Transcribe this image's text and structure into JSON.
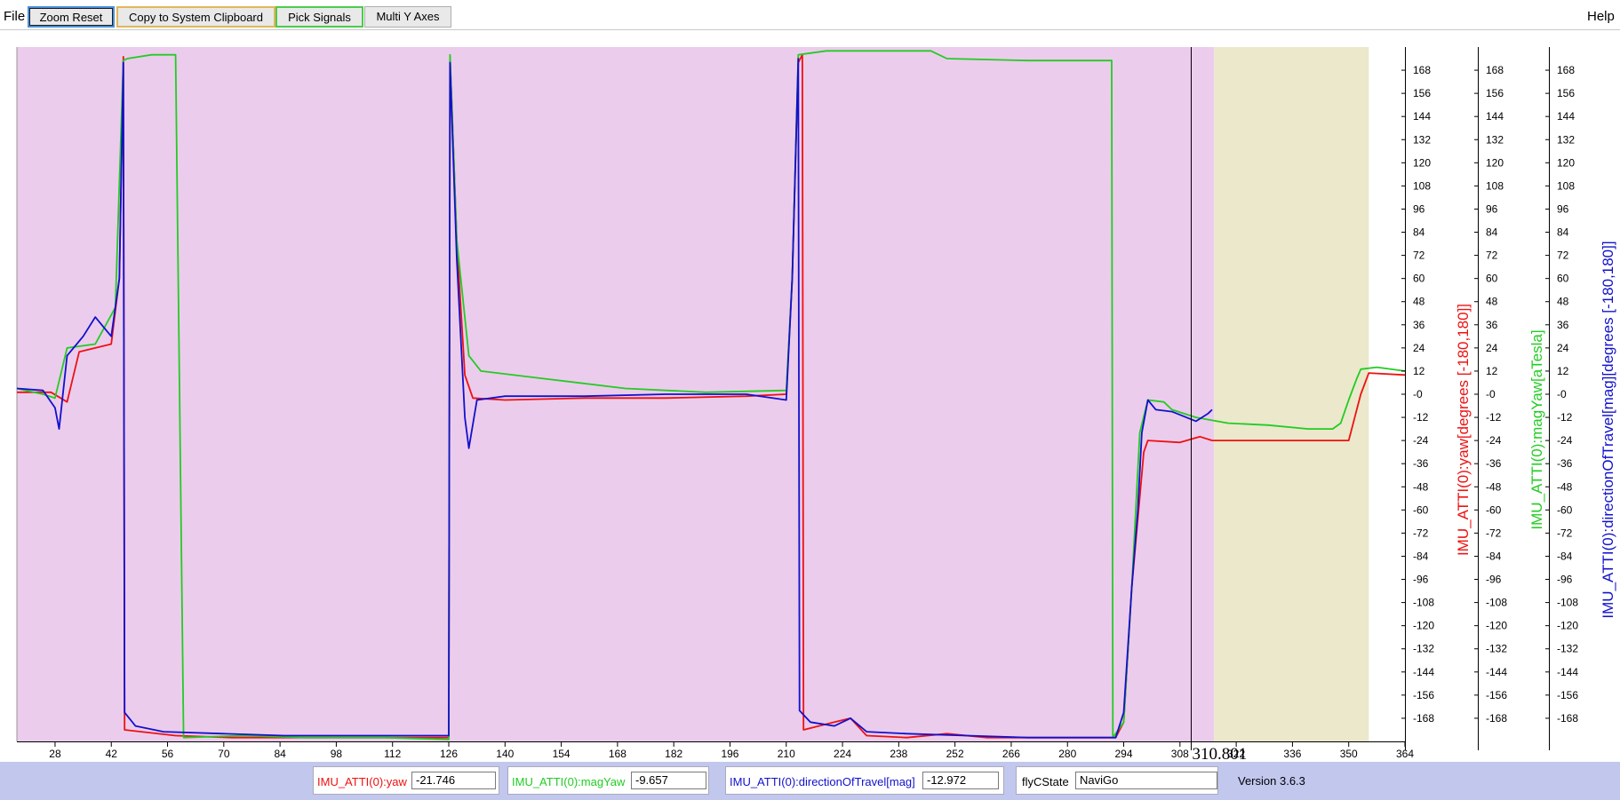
{
  "toolbar": {
    "file_menu": "File",
    "help_menu": "Help",
    "zoom_reset": "Zoom Reset",
    "copy_clipboard": "Copy to System Clipboard",
    "pick_signals": "Pick Signals",
    "multi_y_axes": "Multi Y Axes"
  },
  "status": {
    "yaw_label": "IMU_ATTI(0):yaw",
    "yaw_value": "-21.746",
    "magyaw_label": "IMU_ATTI(0):magYaw",
    "magyaw_value": "-9.657",
    "dir_label": "IMU_ATTI(0):directionOfTravel[mag]",
    "dir_value": "-12.972",
    "flyc_label": "flyCState",
    "flyc_value": "NaviGo",
    "version": "Version 3.6.3"
  },
  "colors": {
    "yaw": "#ee1111",
    "magYaw": "#22cc22",
    "directionOfTravel": "#1111cc",
    "bg_navi": "#ecccec",
    "bg_other": "#ebe8cc"
  },
  "chart_data": {
    "type": "line",
    "cursor_label": "310.801",
    "cursor_x": 310.801,
    "xlim": [
      18.5,
      364
    ],
    "x_ticks": [
      "28",
      "42",
      "56",
      "70",
      "84",
      "98",
      "112",
      "126",
      "140",
      "154",
      "168",
      "182",
      "196",
      "210",
      "224",
      "238",
      "252",
      "266",
      "280",
      "294",
      "308",
      "322",
      "336",
      "350",
      "364"
    ],
    "ylim": [
      -180,
      180
    ],
    "y_ticks": [
      "168",
      "156",
      "144",
      "132",
      "120",
      "108",
      "96",
      "84",
      "72",
      "60",
      "48",
      "36",
      "24",
      "12",
      "-0",
      "-12",
      "-24",
      "-36",
      "-48",
      "-60",
      "-72",
      "-84",
      "-96",
      "-108",
      "-120",
      "-132",
      "-144",
      "-156",
      "-168"
    ],
    "axes": [
      {
        "label": "IMU_ATTI(0):yaw[degrees [-180,180]]",
        "color": "#ee1111"
      },
      {
        "label": "IMU_ATTI(0):magYaw[aTesla]",
        "color": "#22cc22"
      },
      {
        "label": "IMU_ATTI(0):directionOfTravel[mag][degrees [-180,180]]",
        "color": "#1111cc"
      }
    ],
    "background_regions": [
      {
        "from": 18.5,
        "to": 316.5,
        "state": "NaviGo",
        "color": "#ecccec"
      },
      {
        "from": 316.5,
        "to": 355.0,
        "state": "other",
        "color": "#ebe8cc"
      }
    ],
    "series": [
      {
        "name": "IMU_ATTI(0):yaw",
        "color": "#ee1111",
        "points": [
          [
            18.5,
            1
          ],
          [
            27,
            1
          ],
          [
            31,
            -4
          ],
          [
            34,
            22
          ],
          [
            42,
            26
          ],
          [
            44,
            60
          ],
          [
            45,
            175
          ],
          [
            45.3,
            -174
          ],
          [
            58,
            -177
          ],
          [
            72,
            -178
          ],
          [
            84,
            -178
          ],
          [
            100,
            -178
          ],
          [
            114,
            -178
          ],
          [
            126,
            -178
          ],
          [
            126.3,
            175
          ],
          [
            128,
            80
          ],
          [
            130,
            10
          ],
          [
            132,
            -2
          ],
          [
            140,
            -3
          ],
          [
            160,
            -2
          ],
          [
            180,
            -2
          ],
          [
            200,
            -1
          ],
          [
            210,
            0
          ],
          [
            211.5,
            60
          ],
          [
            213,
            172
          ],
          [
            214,
            176
          ],
          [
            214.3,
            -174
          ],
          [
            222,
            -170
          ],
          [
            226,
            -168
          ],
          [
            230,
            -177
          ],
          [
            240,
            -178
          ],
          [
            250,
            -176
          ],
          [
            260,
            -178
          ],
          [
            275,
            -178
          ],
          [
            292,
            -178
          ],
          [
            294,
            -170
          ],
          [
            296,
            -100
          ],
          [
            299,
            -30
          ],
          [
            300,
            -24
          ],
          [
            308,
            -25
          ],
          [
            313,
            -22
          ],
          [
            316,
            -24
          ],
          [
            330,
            -24
          ],
          [
            345,
            -24
          ],
          [
            350,
            -24
          ],
          [
            353,
            0
          ],
          [
            355,
            11
          ],
          [
            364,
            10
          ]
        ]
      },
      {
        "name": "IMU_ATTI(0):magYaw",
        "color": "#22cc22",
        "points": [
          [
            18.5,
            3
          ],
          [
            25,
            0
          ],
          [
            28,
            -2
          ],
          [
            31,
            24
          ],
          [
            38,
            26
          ],
          [
            43,
            45
          ],
          [
            45,
            173
          ],
          [
            46,
            174
          ],
          [
            52,
            176
          ],
          [
            58,
            176
          ],
          [
            60,
            -178
          ],
          [
            75,
            -177
          ],
          [
            90,
            -178
          ],
          [
            110,
            -178
          ],
          [
            126,
            -179
          ],
          [
            126.3,
            176
          ],
          [
            128,
            80
          ],
          [
            131,
            20
          ],
          [
            134,
            12
          ],
          [
            150,
            8
          ],
          [
            170,
            3
          ],
          [
            190,
            1
          ],
          [
            210,
            2
          ],
          [
            211.5,
            60
          ],
          [
            213,
            176
          ],
          [
            220,
            178
          ],
          [
            230,
            178
          ],
          [
            246,
            178
          ],
          [
            250,
            174
          ],
          [
            270,
            173
          ],
          [
            291,
            173
          ],
          [
            291.3,
            -178
          ],
          [
            294,
            -170
          ],
          [
            296,
            -100
          ],
          [
            298,
            -20
          ],
          [
            300,
            -3
          ],
          [
            304,
            -4
          ],
          [
            306,
            -8
          ],
          [
            312,
            -12
          ],
          [
            320,
            -15
          ],
          [
            330,
            -16
          ],
          [
            340,
            -18
          ],
          [
            346,
            -18
          ],
          [
            348,
            -15
          ],
          [
            350,
            -3
          ],
          [
            352,
            8
          ],
          [
            353,
            13
          ],
          [
            357,
            14
          ],
          [
            364,
            12
          ]
        ]
      },
      {
        "name": "IMU_ATTI(0):directionOfTravel[mag]",
        "color": "#1111cc",
        "points": [
          [
            18.5,
            3
          ],
          [
            25,
            2
          ],
          [
            28,
            -7
          ],
          [
            29,
            -18
          ],
          [
            31,
            20
          ],
          [
            35,
            30
          ],
          [
            38,
            40
          ],
          [
            42,
            30
          ],
          [
            44,
            60
          ],
          [
            45,
            172
          ],
          [
            45.3,
            -165
          ],
          [
            48,
            -172
          ],
          [
            55,
            -175
          ],
          [
            70,
            -176
          ],
          [
            85,
            -177
          ],
          [
            100,
            -177
          ],
          [
            115,
            -177
          ],
          [
            126,
            -177
          ],
          [
            126.3,
            172
          ],
          [
            128,
            70
          ],
          [
            130,
            -12
          ],
          [
            131,
            -28
          ],
          [
            133,
            -3
          ],
          [
            140,
            -1
          ],
          [
            160,
            -1
          ],
          [
            180,
            0
          ],
          [
            200,
            0
          ],
          [
            210,
            -3
          ],
          [
            211.5,
            60
          ],
          [
            213,
            174
          ],
          [
            213.3,
            -164
          ],
          [
            216,
            -170
          ],
          [
            222,
            -172
          ],
          [
            226,
            -168
          ],
          [
            230,
            -175
          ],
          [
            240,
            -176
          ],
          [
            255,
            -177
          ],
          [
            270,
            -178
          ],
          [
            292,
            -178
          ],
          [
            294,
            -165
          ],
          [
            296,
            -100
          ],
          [
            297.5,
            -60
          ],
          [
            298.5,
            -20
          ],
          [
            300,
            -3
          ],
          [
            302,
            -8
          ],
          [
            306,
            -9
          ],
          [
            312,
            -14
          ],
          [
            315,
            -10
          ],
          [
            316,
            -8
          ]
        ]
      }
    ]
  }
}
